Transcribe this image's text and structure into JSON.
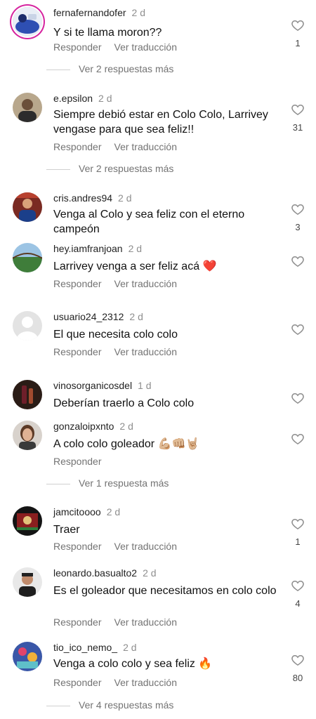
{
  "comments": [
    {
      "user": "fernafernandofer",
      "time": "2 d",
      "text": "Y si te llama moron??",
      "reply": "Responder",
      "translate": "Ver traducción",
      "likes": "1"
    },
    {
      "user": "e.epsilon",
      "time": "2 d",
      "text": "Siempre debió estar en Colo Colo, Larrivey vengase para que sea feliz!!",
      "reply": "Responder",
      "translate": "Ver traducción",
      "likes": "31"
    },
    {
      "user": "cris.andres94",
      "time": "2 d",
      "text": "Venga al Colo y sea feliz con el eterno campeón",
      "likes": "3"
    },
    {
      "user": "hey.iamfranjoan",
      "time": "2 d",
      "text": "Larrivey venga a ser feliz acá ❤️",
      "reply": "Responder",
      "translate": "Ver traducción"
    },
    {
      "user": "usuario24_2312",
      "time": "2 d",
      "text": "El que necesita colo colo",
      "reply": "Responder",
      "translate": "Ver traducción"
    },
    {
      "user": "vinosorganicosdel",
      "time": "1 d",
      "text": "Deberían traerlo a Colo colo"
    },
    {
      "user": "gonzaloipxnto",
      "time": "2 d",
      "text": "A colo colo goleador 💪🏼👊🏼🤘🏼",
      "reply": "Responder"
    },
    {
      "user": "jamcitoooo",
      "time": "2 d",
      "text": "Traer",
      "reply": "Responder",
      "translate": "Ver traducción",
      "likes": "1"
    },
    {
      "user": "leonardo.basualto2",
      "time": "2 d",
      "text": "Es el goleador que necesitamos en colo colo",
      "reply": "Responder",
      "translate": "Ver traducción",
      "likes": "4"
    },
    {
      "user": "tio_ico_nemo_",
      "time": "2 d",
      "text": "Venga a colo colo y sea feliz 🔥",
      "reply": "Responder",
      "translate": "Ver traducción",
      "likes": "80"
    }
  ],
  "more_replies": [
    "Ver 2 respuestas más",
    "Ver 2 respuestas más",
    "Ver 1 respuesta más",
    "Ver 4 respuestas más"
  ],
  "icons": {
    "like": "heart-outline-icon",
    "avatar_placeholder": "default-avatar-icon"
  }
}
